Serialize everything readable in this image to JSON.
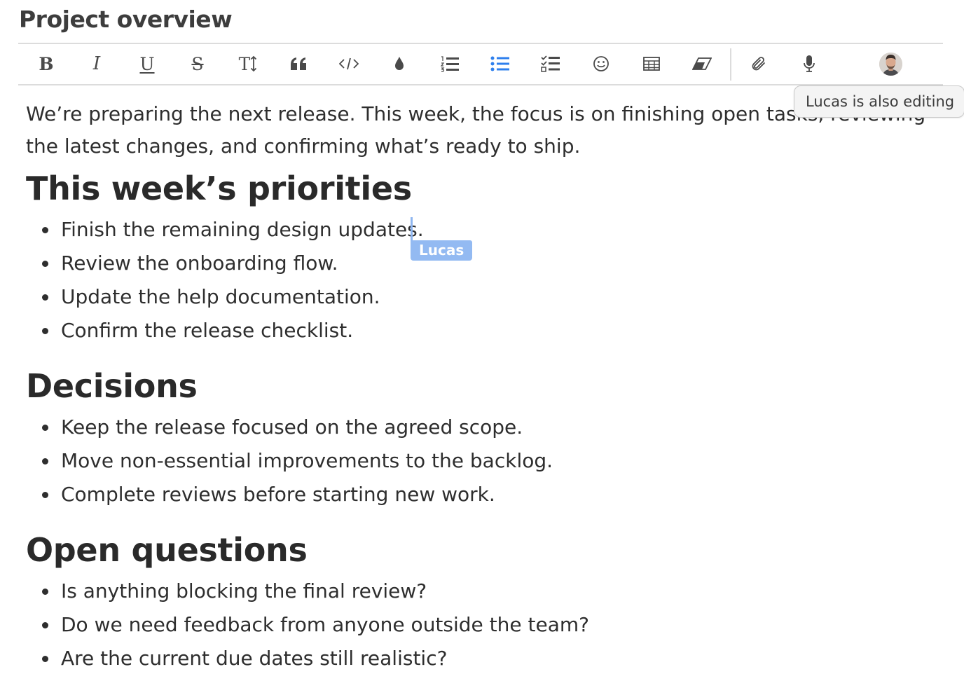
{
  "document": {
    "title": "Project overview",
    "intro": "We’re preparing the next release. This week, the focus is on finishing open tasks, reviewing the latest changes, and confirming what’s ready to ship.",
    "sections": [
      {
        "heading": "This week’s priorities",
        "items": [
          "Finish the remaining design updates.",
          "Review the onboarding flow.",
          "Update the help documentation.",
          "Confirm the release checklist."
        ]
      },
      {
        "heading": "Decisions",
        "items": [
          "Keep the release focused on the agreed scope.",
          "Move non-essential improvements to the backlog.",
          "Complete reviews before starting new work."
        ]
      },
      {
        "heading": "Open questions",
        "items": [
          "Is anything blocking the final review?",
          "Do we need feedback from anyone outside the team?",
          "Are the current due dates still realistic?"
        ]
      }
    ]
  },
  "toolbar": {
    "bold_label": "B",
    "italic_label": "I",
    "underline_label": "U",
    "strike_label": "S",
    "heading_label": "T",
    "buttons": [
      "bold-icon",
      "italic-icon",
      "underline-icon",
      "strikethrough-icon",
      "text-size-icon",
      "quote-icon",
      "code-icon",
      "color-drop-icon",
      "numbered-list-icon",
      "bulleted-list-icon",
      "checklist-icon",
      "emoji-icon",
      "table-icon",
      "eraser-icon",
      "paperclip-icon",
      "microphone-icon"
    ],
    "active_button": "bulleted-list-icon",
    "icon_color": "#4a4a4a",
    "active_color": "#2f80ed"
  },
  "collaboration": {
    "cursor_name": "Lucas",
    "tooltip": "Lucas is also editing",
    "cursor_color": "#93baf2"
  }
}
